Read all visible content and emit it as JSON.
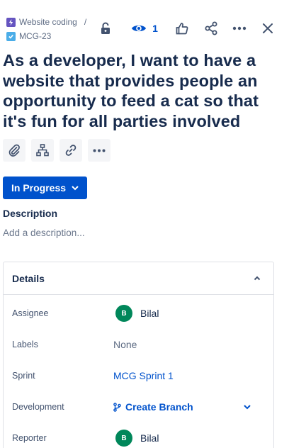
{
  "breadcrumb": {
    "parent_label": "Website coding",
    "separator": "/",
    "issue_key": "MCG-23"
  },
  "toolbar": {
    "watch_count": "1",
    "icons": [
      "lock-icon",
      "eye-icon",
      "thumbs-up-icon",
      "share-icon",
      "more-icon",
      "close-icon"
    ]
  },
  "issue": {
    "title": "As a developer, I want to have a website that provides people an opportunity to feed a cat so that it's fun for all parties involved",
    "status": "In Progress"
  },
  "quick_actions": [
    "attach-icon",
    "child-issue-icon",
    "link-icon",
    "more-icon"
  ],
  "description": {
    "label": "Description",
    "placeholder": "Add a description..."
  },
  "details": {
    "title": "Details",
    "rows": [
      {
        "label": "Assignee",
        "value": "Bilal",
        "avatar_initial": "B"
      },
      {
        "label": "Labels",
        "value": "None"
      },
      {
        "label": "Sprint",
        "value": "MCG Sprint 1"
      },
      {
        "label": "Development",
        "value": "Create Branch"
      },
      {
        "label": "Reporter",
        "value": "Bilal",
        "avatar_initial": "B"
      }
    ]
  },
  "colors": {
    "primary": "#0052cc",
    "text": "#172b4d",
    "epic": "#6554c0",
    "task": "#4bade8",
    "avatar": "#00875a"
  }
}
